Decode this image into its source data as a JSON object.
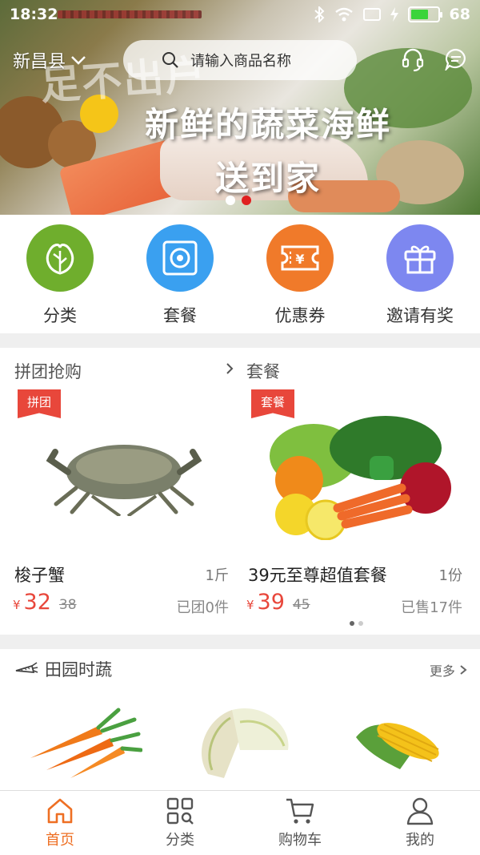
{
  "status_bar": {
    "time": "18:32",
    "battery": "68",
    "battery_level": 0.68
  },
  "header": {
    "location": "新昌县",
    "search_placeholder": "请输入商品名称",
    "icons": [
      "headset-icon",
      "message-icon"
    ]
  },
  "banner": {
    "line1": "足不出户",
    "line2": "新鲜的蔬菜海鲜",
    "line3": "送到家",
    "slides": 2,
    "active_slide": 2
  },
  "quick_menu": [
    {
      "label": "分类",
      "icon": "vegetable-icon",
      "color": "#6fae2d"
    },
    {
      "label": "套餐",
      "icon": "box-icon",
      "color": "#3aa0f0"
    },
    {
      "label": "优惠券",
      "icon": "coupon-icon",
      "color": "#f07a2a"
    },
    {
      "label": "邀请有奖",
      "icon": "gift-icon",
      "color": "#7d87f0"
    }
  ],
  "deals": {
    "left_title": "拼团抢购",
    "right_title": "套餐",
    "items": [
      {
        "tag": "拼团",
        "name": "梭子蟹",
        "unit": "1斤",
        "currency": "¥",
        "price": "32",
        "original": "38",
        "sold": "已团0件"
      },
      {
        "tag": "套餐",
        "name": "39元至尊超值套餐",
        "unit": "1份",
        "currency": "¥",
        "price": "39",
        "original": "45",
        "sold": "已售17件"
      }
    ]
  },
  "section": {
    "title": "田园时蔬",
    "more": "更多"
  },
  "bottom_nav": [
    {
      "label": "首页",
      "icon": "home-icon",
      "active": true
    },
    {
      "label": "分类",
      "icon": "category-icon",
      "active": false
    },
    {
      "label": "购物车",
      "icon": "cart-icon",
      "active": false
    },
    {
      "label": "我的",
      "icon": "user-icon",
      "active": false
    }
  ],
  "colors": {
    "accent": "#ee6f23",
    "price": "#e8473b"
  }
}
